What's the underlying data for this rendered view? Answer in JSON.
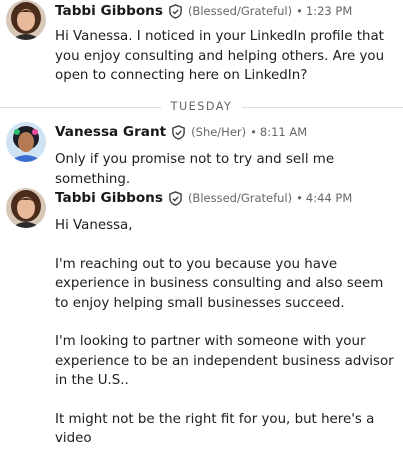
{
  "messages": [
    {
      "sender": "Tabbi Gibbons",
      "pronouns": "(Blessed/Grateful)",
      "separator": "•",
      "time": "1:23 PM",
      "paragraphs": [
        "Hi Vanessa. I noticed in your LinkedIn profile that you enjoy consulting and helping others. Are you open to connecting here on LinkedIn?"
      ]
    },
    {
      "sender": "Vanessa Grant",
      "pronouns": "(She/Her)",
      "separator": "•",
      "time": "8:11 AM",
      "paragraphs": [
        "Only if you promise not to try and sell me something."
      ]
    },
    {
      "sender": "Tabbi Gibbons",
      "pronouns": "(Blessed/Grateful)",
      "separator": "•",
      "time": "4:44 PM",
      "paragraphs": [
        "Hi Vanessa,",
        "I'm reaching out to you because you have experience in business consulting and also seem to enjoy helping small businesses succeed.",
        "I'm looking to partner with someone with your experience to be an independent business advisor in the U.S..",
        "It might not be the right fit for you, but here's a video"
      ]
    }
  ],
  "day_divider": "TUESDAY",
  "icons": {
    "verified": "verified-shield-icon"
  },
  "colors": {
    "muted_text": "#666666",
    "divider": "#e0dfdc",
    "name_text": "#191919"
  }
}
